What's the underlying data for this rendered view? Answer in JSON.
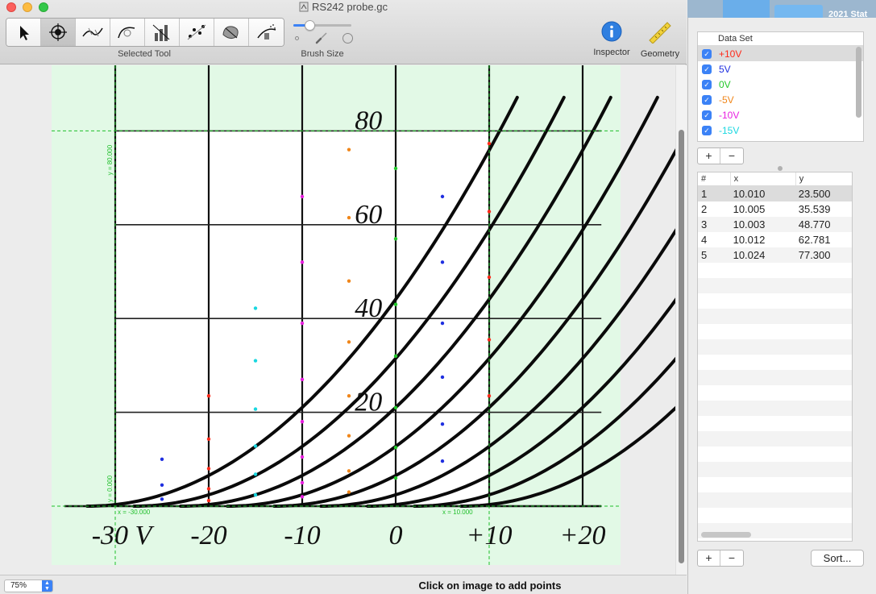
{
  "window": {
    "title": "RS242 probe.gc"
  },
  "toolbar": {
    "tools": [
      {
        "name": "pointer-tool",
        "icon": "arrow-pointer-icon"
      },
      {
        "name": "add-point-tool",
        "icon": "crosshair-target-icon"
      },
      {
        "name": "auto-trace-line-tool",
        "icon": "trace-curve-icon"
      },
      {
        "name": "auto-trace-arc-tool",
        "icon": "trace-arc-icon"
      },
      {
        "name": "bar-trace-tool",
        "icon": "bar-trace-icon"
      },
      {
        "name": "scatter-trace-tool",
        "icon": "scatter-trace-icon"
      },
      {
        "name": "region-trace-tool",
        "icon": "region-trace-icon"
      },
      {
        "name": "spray-trace-tool",
        "icon": "spray-trace-icon"
      }
    ],
    "selected_tool_index": 1,
    "selected_tool_label": "Selected Tool",
    "brush_size_label": "Brush Size",
    "brush_size_fraction": 0.28,
    "inspector_label": "Inspector",
    "geometry_label": "Geometry"
  },
  "status": {
    "zoom": "75%",
    "message": "Click on image to add points"
  },
  "desktop": {
    "item_label": "2021 Stat"
  },
  "datasets": {
    "header": "Data Set",
    "items": [
      {
        "label": "+10V",
        "color": "#ff2a1a",
        "checked": true,
        "selected": true
      },
      {
        "label": "5V",
        "color": "#1f2fe0",
        "checked": true,
        "selected": false
      },
      {
        "label": "0V",
        "color": "#22c82a",
        "checked": true,
        "selected": false
      },
      {
        "label": "-5V",
        "color": "#f0861a",
        "checked": true,
        "selected": false
      },
      {
        "label": "-10V",
        "color": "#e81ee0",
        "checked": true,
        "selected": false
      },
      {
        "label": "-15V",
        "color": "#19d7e0",
        "checked": true,
        "selected": false
      }
    ]
  },
  "points": {
    "headers": [
      "#",
      "x",
      "y"
    ],
    "rows": [
      [
        "1",
        "10.010",
        "23.500"
      ],
      [
        "2",
        "10.005",
        "35.539"
      ],
      [
        "3",
        "10.003",
        "48.770"
      ],
      [
        "4",
        "10.012",
        "62.781"
      ],
      [
        "5",
        "10.024",
        "77.300"
      ]
    ],
    "sort_label": "Sort..."
  },
  "plot": {
    "background_color": "#e2f9e6",
    "ymax_label": "y = 80.000",
    "ymin_label": "y = 0.000",
    "xmin_label": "x = -30.000",
    "xmax_label": "x = 10.000",
    "x_tick_labels": [
      "-30 V",
      "-20",
      "-10",
      "0",
      "+10",
      "+20"
    ],
    "y_tick_labels": [
      "80",
      "60",
      "40",
      "20"
    ],
    "curve_x0": [
      -27,
      -22,
      -17,
      -12,
      -7,
      -2,
      3,
      8,
      13
    ],
    "markers": [
      {
        "x": -20,
        "y": 23.5,
        "c": "#ff2a1a"
      },
      {
        "x": -20,
        "y": 14.3,
        "c": "#ff2a1a"
      },
      {
        "x": -20,
        "y": 8.0,
        "c": "#ff2a1a"
      },
      {
        "x": -20,
        "y": 3.7,
        "c": "#ff2a1a"
      },
      {
        "x": -20,
        "y": 1.2,
        "c": "#ff2a1a"
      },
      {
        "x": 10,
        "y": 23.5,
        "c": "#ff2a1a"
      },
      {
        "x": 10,
        "y": 35.5,
        "c": "#ff2a1a"
      },
      {
        "x": 10,
        "y": 48.8,
        "c": "#ff2a1a"
      },
      {
        "x": 10,
        "y": 62.8,
        "c": "#ff2a1a"
      },
      {
        "x": 10,
        "y": 77.3,
        "c": "#ff2a1a"
      },
      {
        "x": -25,
        "y": 10.0,
        "c": "#1f2fe0"
      },
      {
        "x": -25,
        "y": 4.5,
        "c": "#1f2fe0"
      },
      {
        "x": -25,
        "y": 1.5,
        "c": "#1f2fe0"
      },
      {
        "x": 5,
        "y": 9.6,
        "c": "#1f2fe0"
      },
      {
        "x": 5,
        "y": 17.5,
        "c": "#1f2fe0"
      },
      {
        "x": 5,
        "y": 27.5,
        "c": "#1f2fe0"
      },
      {
        "x": 5,
        "y": 39.0,
        "c": "#1f2fe0"
      },
      {
        "x": 5,
        "y": 52.0,
        "c": "#1f2fe0"
      },
      {
        "x": 5,
        "y": 66.0,
        "c": "#1f2fe0"
      },
      {
        "x": 0,
        "y": 6.0,
        "c": "#22c82a"
      },
      {
        "x": 0,
        "y": 12.5,
        "c": "#22c82a"
      },
      {
        "x": 0,
        "y": 21.0,
        "c": "#22c82a"
      },
      {
        "x": 0,
        "y": 32.0,
        "c": "#22c82a"
      },
      {
        "x": 0,
        "y": 43.0,
        "c": "#22c82a"
      },
      {
        "x": 0,
        "y": 57.0,
        "c": "#22c82a"
      },
      {
        "x": 0,
        "y": 72.0,
        "c": "#22c82a"
      },
      {
        "x": -5,
        "y": 3.0,
        "c": "#f0861a"
      },
      {
        "x": -5,
        "y": 7.5,
        "c": "#f0861a"
      },
      {
        "x": -5,
        "y": 15.0,
        "c": "#f0861a"
      },
      {
        "x": -5,
        "y": 23.5,
        "c": "#f0861a"
      },
      {
        "x": -5,
        "y": 35.0,
        "c": "#f0861a"
      },
      {
        "x": -5,
        "y": 48.0,
        "c": "#f0861a"
      },
      {
        "x": -5,
        "y": 61.5,
        "c": "#f0861a"
      },
      {
        "x": -5,
        "y": 76.0,
        "c": "#f0861a"
      },
      {
        "x": -10,
        "y": 2.0,
        "c": "#e81ee0"
      },
      {
        "x": -10,
        "y": 5.0,
        "c": "#e81ee0"
      },
      {
        "x": -10,
        "y": 10.5,
        "c": "#e81ee0"
      },
      {
        "x": -10,
        "y": 18.0,
        "c": "#e81ee0"
      },
      {
        "x": -10,
        "y": 27.0,
        "c": "#e81ee0"
      },
      {
        "x": -10,
        "y": 39.0,
        "c": "#e81ee0"
      },
      {
        "x": -10,
        "y": 52.0,
        "c": "#e81ee0"
      },
      {
        "x": -10,
        "y": 66.0,
        "c": "#e81ee0"
      },
      {
        "x": -15,
        "y": 2.4,
        "c": "#19d7e0"
      },
      {
        "x": -15,
        "y": 6.8,
        "c": "#19d7e0"
      },
      {
        "x": -15,
        "y": 12.8,
        "c": "#19d7e0"
      },
      {
        "x": -15,
        "y": 20.7,
        "c": "#19d7e0"
      },
      {
        "x": -15,
        "y": 31.0,
        "c": "#19d7e0"
      },
      {
        "x": -15,
        "y": 42.2,
        "c": "#19d7e0"
      }
    ]
  }
}
